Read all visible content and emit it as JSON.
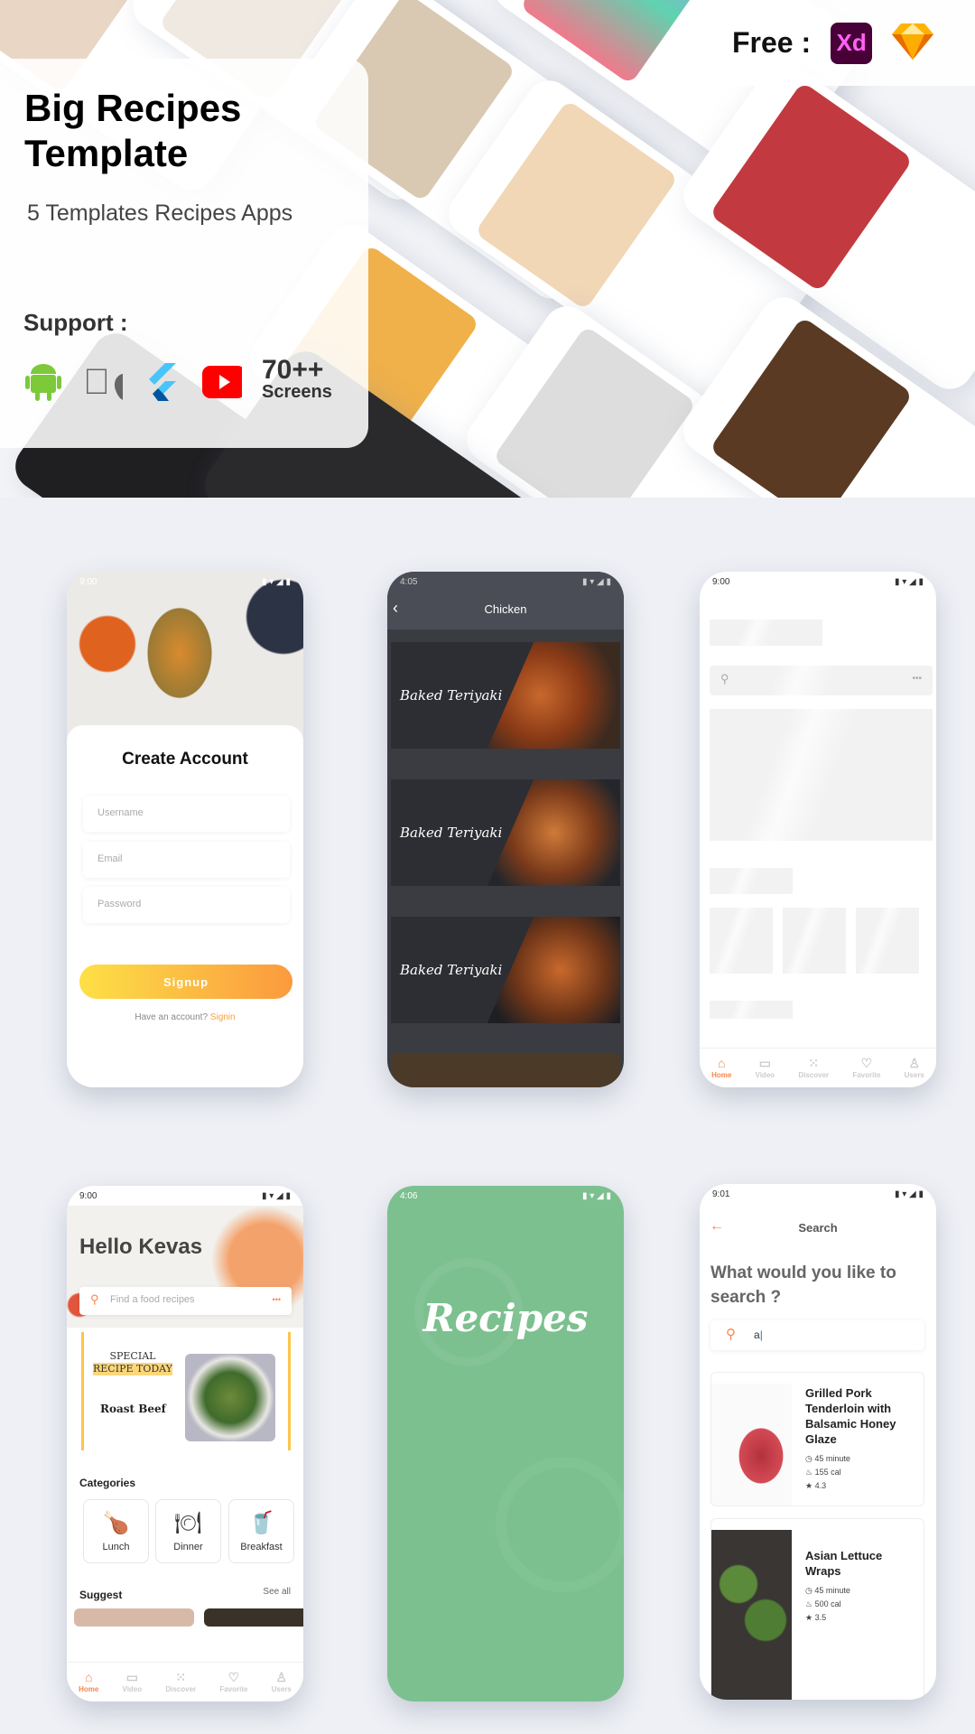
{
  "banner": {
    "title": "Big Recipes Template",
    "subtitle": "5 Templates Recipes Apps",
    "support_label": "Support :",
    "screens_count": "70++",
    "screens_label": "Screens",
    "free_label": "Free :",
    "xd_label": "Xd",
    "platforms": [
      "android-icon",
      "apple-icon",
      "flutter-icon",
      "youtube-icon"
    ]
  },
  "login": {
    "time": "9:00",
    "title": "Create Account",
    "fields": [
      "Username",
      "Email",
      "Password"
    ],
    "button": "Signup",
    "have_account": "Have an account?",
    "signin": "Signin"
  },
  "chicken": {
    "time": "4:05",
    "title": "Chicken",
    "items": [
      "Baked Teriyaki",
      "Baked Teriyaki",
      "Baked Teriyaki"
    ]
  },
  "skeleton": {
    "time": "9:00",
    "nav": [
      "Home",
      "Video",
      "Discover",
      "Favorite",
      "Users"
    ]
  },
  "home": {
    "time": "9:00",
    "greeting": "Hello Kevas",
    "search_placeholder": "Find a food recipes",
    "special_line1": "SPECIAL",
    "special_line2": "RECIPE TODAY",
    "special_dish": "Roast Beef",
    "categories_label": "Categories",
    "categories": [
      "Lunch",
      "Dinner",
      "Breakfast"
    ],
    "suggest_label": "Suggest",
    "see_all": "See all",
    "nav": [
      "Home",
      "Video",
      "Discover",
      "Favorite",
      "Users"
    ]
  },
  "splash": {
    "time": "4:06",
    "title": "Recipes",
    "bg": "#7cc08f"
  },
  "search": {
    "time": "9:01",
    "title": "Search",
    "question": "What would you like to search ?",
    "query": "a",
    "results": [
      {
        "name": "Grilled Pork Tenderloin with Balsamic Honey Glaze",
        "time": "45 minute",
        "cal": "155 cal",
        "rating": "4.3"
      },
      {
        "name": "Asian Lettuce Wraps",
        "time": "45 minute",
        "cal": "500 cal",
        "rating": "3.5"
      }
    ]
  },
  "colors": {
    "accent": "#f6874a",
    "yellow": "#fcd34d",
    "bg": "#eef0f5"
  }
}
